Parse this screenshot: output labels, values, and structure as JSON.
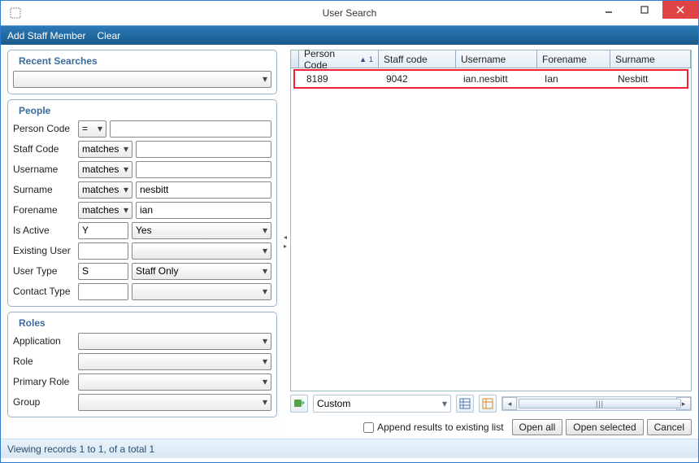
{
  "window": {
    "title": "User Search"
  },
  "toolbar": {
    "add_staff": "Add Staff Member",
    "clear": "Clear"
  },
  "panels": {
    "recent": {
      "legend": "Recent Searches"
    },
    "people": {
      "legend": "People",
      "rows": {
        "person_code": {
          "label": "Person Code",
          "op": "=",
          "value": ""
        },
        "staff_code": {
          "label": "Staff Code",
          "op": "matches",
          "value": ""
        },
        "username": {
          "label": "Username",
          "op": "matches",
          "value": ""
        },
        "surname": {
          "label": "Surname",
          "op": "matches",
          "value": "nesbitt"
        },
        "forename": {
          "label": "Forename",
          "op": "matches",
          "value": "ian"
        },
        "is_active": {
          "label": "Is Active",
          "code": "Y",
          "text": "Yes"
        },
        "existing": {
          "label": "Existing User",
          "code": "",
          "text": ""
        },
        "user_type": {
          "label": "User Type",
          "code": "S",
          "text": "Staff Only"
        },
        "contact": {
          "label": "Contact Type",
          "code": "",
          "text": ""
        }
      }
    },
    "roles": {
      "legend": "Roles",
      "application": "Application",
      "role": "Role",
      "primary_role": "Primary Role",
      "group": "Group"
    }
  },
  "grid": {
    "columns": [
      "Person Code",
      "Staff code",
      "Username",
      "Forename",
      "Surname"
    ],
    "sort_indicator": "1",
    "rows": [
      {
        "person_code": "8189",
        "staff_code": "9042",
        "username": "ian.nesbitt",
        "forename": "Ian",
        "surname": "Nesbitt"
      }
    ]
  },
  "bottom": {
    "view_mode": "Custom",
    "append_label": "Append results to existing list",
    "open_all": "Open all",
    "open_selected": "Open selected",
    "cancel": "Cancel"
  },
  "status": "Viewing records 1 to 1, of a total 1"
}
